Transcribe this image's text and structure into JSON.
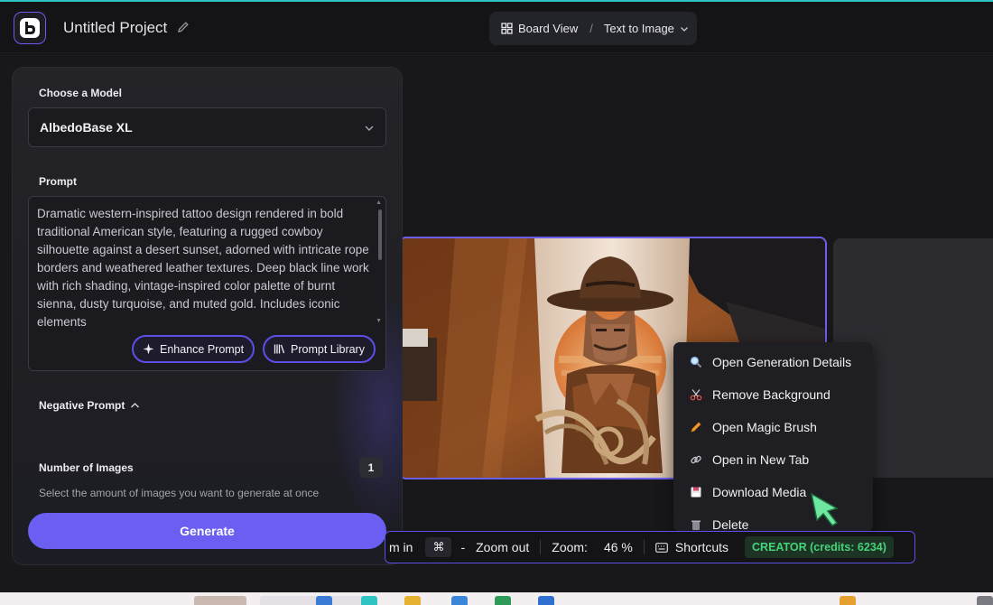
{
  "header": {
    "project_title": "Untitled Project",
    "view_label": "Board View",
    "separator": "/",
    "mode_label": "Text to Image"
  },
  "panel": {
    "model_label": "Choose a Model",
    "model_value": "AlbedoBase XL",
    "prompt_label": "Prompt",
    "prompt_text": "Dramatic western-inspired tattoo design rendered in bold traditional American style, featuring a rugged cowboy silhouette against a desert sunset, adorned with intricate rope borders and weathered leather textures. Deep black line work with rich shading, vintage-inspired color palette of burnt sienna, dusty turquoise, and muted gold. Includes iconic elements",
    "enhance_label": "Enhance Prompt",
    "library_label": "Prompt Library",
    "negative_label": "Negative Prompt",
    "num_images_label": "Number of Images",
    "num_images_value": "1",
    "num_images_helper": "Select the amount of images you want to generate at once",
    "generate_label": "Generate"
  },
  "context_menu": {
    "items": [
      {
        "label": "Open Generation Details",
        "icon": "magnifier-icon"
      },
      {
        "label": "Remove Background",
        "icon": "scissors-icon"
      },
      {
        "label": "Open Magic Brush",
        "icon": "pencil-icon"
      },
      {
        "label": "Open in New Tab",
        "icon": "link-icon"
      },
      {
        "label": "Download Media",
        "icon": "floppy-disk-icon"
      },
      {
        "label": "Delete",
        "icon": "trash-icon"
      }
    ]
  },
  "toolbar": {
    "zoom_in_label": "m in",
    "zoom_out_key_cmd": "⌘",
    "zoom_out_key_minus": "-",
    "zoom_out_label": "Zoom out",
    "zoom_label": "Zoom:",
    "zoom_value": "46 %",
    "shortcuts_label": "Shortcuts",
    "credits_label": "CREATOR (credits: 6234)"
  },
  "colors": {
    "accent": "#6a5ff0",
    "credits_green": "#45d37a",
    "background": "#18181b"
  }
}
